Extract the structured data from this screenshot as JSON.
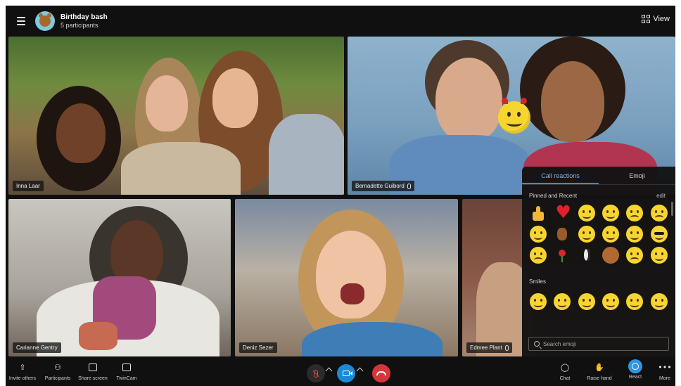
{
  "header": {
    "title": "Birthday bash",
    "subtitle": "5 participants",
    "view_label": "View"
  },
  "participants": [
    {
      "name": "Inna Laar"
    },
    {
      "name": "Bernadette Guibord"
    },
    {
      "name": "Carianne Gentry"
    },
    {
      "name": "Deniz Sezer"
    },
    {
      "name": "Edmee Plant"
    }
  ],
  "reactions_panel": {
    "tabs": [
      "Call reactions",
      "Emoji"
    ],
    "active_tab": "Call reactions",
    "section_pinned": "Pinned and Recent",
    "edit_label": "edit",
    "section_smiles": "Smiles",
    "search_placeholder": "Search emoji",
    "pinned_emojis": [
      "thumbs-up",
      "heart",
      "laugh",
      "surprised",
      "cry",
      "sad",
      "thinking",
      "dog",
      "in-love",
      "kiss",
      "rofl",
      "cool",
      "worried",
      "rose",
      "penguin",
      "bear",
      "sick",
      "wink"
    ],
    "smiles_emojis": [
      "smile",
      "cheeky",
      "happy",
      "laugh",
      "smile-big",
      "wink"
    ]
  },
  "bottom_bar": {
    "left": [
      "Invite others",
      "Participants",
      "Share screen",
      "TwinCam"
    ],
    "right": [
      "Chat",
      "Raise hand",
      "React",
      "More"
    ]
  },
  "colors": {
    "accent": "#2f8fe0",
    "end_call": "#d4363a",
    "background": "#101010"
  }
}
